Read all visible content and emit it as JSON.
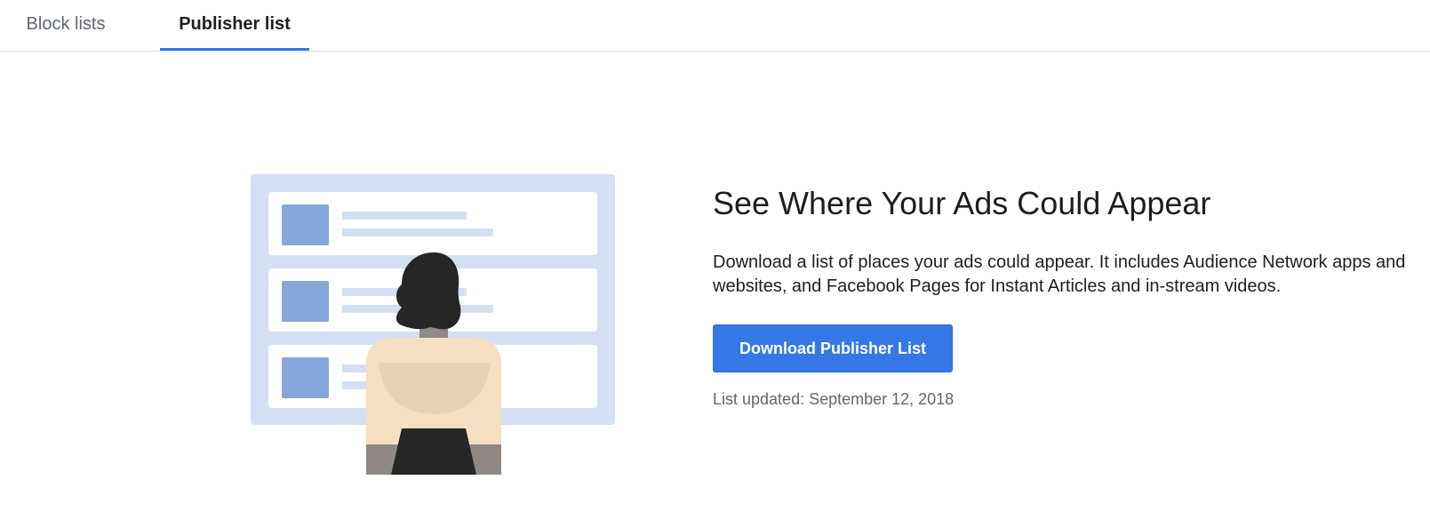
{
  "tabs": {
    "block_lists": "Block lists",
    "publisher_list": "Publisher list",
    "active": "publisher_list"
  },
  "main": {
    "title": "See Where Your Ads Could Appear",
    "description": "Download a list of places your ads could appear. It includes Audience Network apps and websites, and Facebook Pages for Instant Articles and in-stream videos.",
    "download_label": "Download Publisher List",
    "updated": "List updated: September 12, 2018"
  },
  "colors": {
    "accent": "#3578e5",
    "text_primary": "#1c1e21",
    "text_secondary": "#606770",
    "illustration_panel": "#d4e0f2",
    "illustration_block": "#85a6d8"
  },
  "illustration": {
    "name": "person-viewing-publisher-list-illustration"
  }
}
